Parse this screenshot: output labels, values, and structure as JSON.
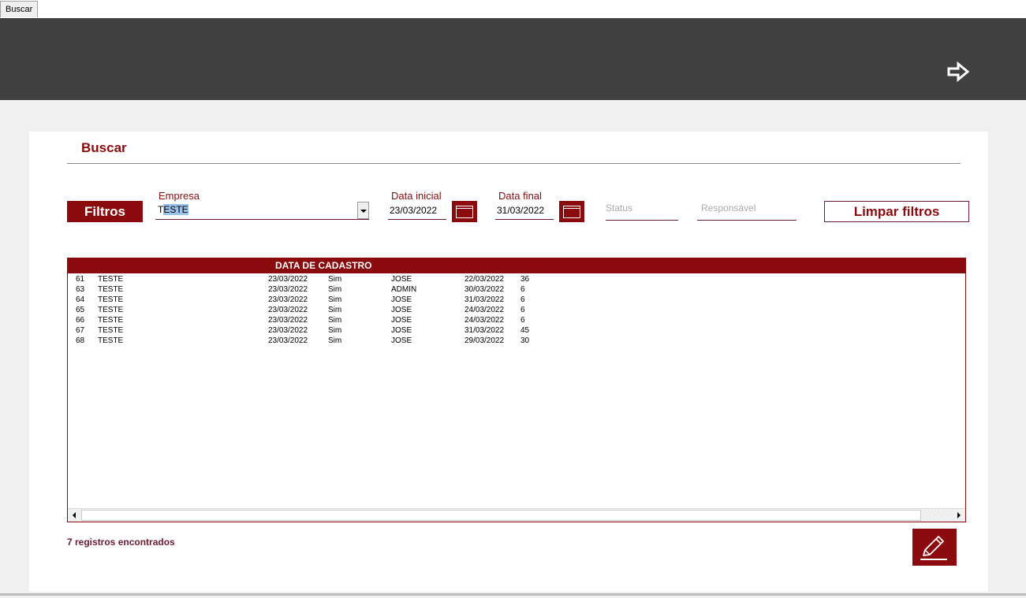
{
  "tabs": [
    {
      "label": "Buscar"
    }
  ],
  "page": {
    "title": "Buscar"
  },
  "filters": {
    "section_label": "Filtros",
    "empresa": {
      "label": "Empresa",
      "value_selected": "ESTE",
      "value_prefix": "T"
    },
    "data_inicial": {
      "label": "Data inicial",
      "value": "23/03/2022"
    },
    "data_final": {
      "label": "Data final",
      "value": "31/03/2022"
    },
    "status": {
      "placeholder": "Status"
    },
    "responsavel": {
      "placeholder": "Responsável"
    },
    "clear_button": "Limpar filtros"
  },
  "list": {
    "header": "DATA DE CADASTRO",
    "rows": [
      [
        "61",
        "TESTE",
        "23/03/2022",
        "Sim",
        "JOSE",
        "22/03/2022",
        "36"
      ],
      [
        "63",
        "TESTE",
        "23/03/2022",
        "Sim",
        "ADMIN",
        "30/03/2022",
        "6"
      ],
      [
        "64",
        "TESTE",
        "23/03/2022",
        "Sim",
        "JOSE",
        "31/03/2022",
        "6"
      ],
      [
        "65",
        "TESTE",
        "23/03/2022",
        "Sim",
        "JOSE",
        "24/03/2022",
        "6"
      ],
      [
        "66",
        "TESTE",
        "23/03/2022",
        "Sim",
        "JOSE",
        "24/03/2022",
        "6"
      ],
      [
        "67",
        "TESTE",
        "23/03/2022",
        "Sim",
        "JOSE",
        "31/03/2022",
        "45"
      ],
      [
        "68",
        "TESTE",
        "23/03/2022",
        "Sim",
        "JOSE",
        "29/03/2022",
        "30"
      ]
    ]
  },
  "footer": {
    "count_text": "7 registros encontrados"
  },
  "icons": {
    "exit": "arrow-right-outline-icon",
    "calendar": "calendar-icon",
    "edit": "pencil-icon"
  },
  "colors": {
    "accent": "#8b0a0e",
    "topbar": "#404040",
    "background": "#f0f0f0"
  }
}
